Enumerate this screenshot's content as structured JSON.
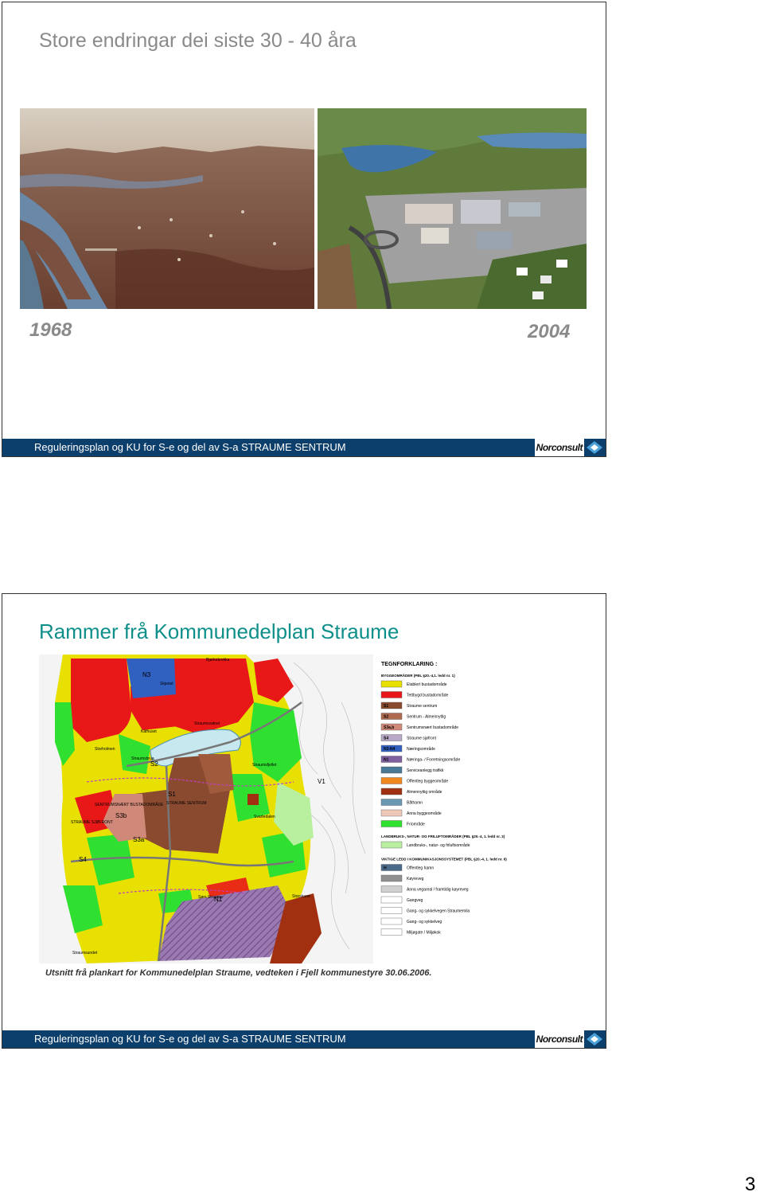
{
  "slides": [
    {
      "title": "Store endringar dei siste 30 - 40 åra",
      "photos": [
        {
          "year": "1968"
        },
        {
          "year": "2004"
        }
      ],
      "footer": "Reguleringsplan og KU for S-e og del av S-a STRAUME SENTRUM",
      "logo": "Norconsult"
    },
    {
      "title": "Rammer frå Kommunedelplan Straume",
      "map": {
        "labels": [
          "N3",
          "Skjenet",
          "S1",
          "STRAUME SENTRUM",
          "S2",
          "S3b",
          "S3a",
          "S4",
          "N1",
          "V1",
          "Storholmen",
          "Kåfhuset",
          "Straumsundet",
          "Sørs Straume",
          "Storskaret",
          "STRAUME SJØFRONT",
          "SENTRUMSNÆRT BUSTADOMRÅDE",
          "Straumsfjellet",
          "Svartedalen",
          "Bjørkebrekka",
          "Straumsvatnet",
          "Straumsbrua"
        ],
        "legend_title": "TEGNFORKLARING :",
        "legend_section1": "BYGGEOMRÅDER (PBL §20.-4,1. ledd nr. 1)",
        "legend_items1": [
          {
            "code": "",
            "label": "Etablert bustadområde",
            "color": "#e8e000"
          },
          {
            "code": "",
            "label": "Tettbygd bustadområde",
            "color": "#e81818"
          },
          {
            "code": "S1",
            "label": "Straume sentrum",
            "color": "#8a4a30"
          },
          {
            "code": "S2",
            "label": "Sentrum - Almennyttig",
            "color": "#b06a50"
          },
          {
            "code": "S3a,b",
            "label": "Sentrumsnært bustadområde",
            "color": "#d08878"
          },
          {
            "code": "S4",
            "label": "Straume sjøfront",
            "color": "#b8a8c8"
          },
          {
            "code": "N3-N4",
            "label": "Næringsområde",
            "color": "#3060c0"
          },
          {
            "code": "N1",
            "label": "Næringa- / Forretningsområde",
            "color": "#8060a0"
          },
          {
            "code": "",
            "label": "Serviceanlegg trafikk",
            "color": "#4a7a98"
          },
          {
            "code": "",
            "label": "Offentleg byggeområde",
            "color": "#f08820"
          },
          {
            "code": "",
            "label": "Almennyttig område",
            "color": "#a03010"
          },
          {
            "code": "",
            "label": "Båthamn",
            "color": "#6a98b0"
          },
          {
            "code": "",
            "label": "Anna byggeområde",
            "color": "#f0c8b8"
          },
          {
            "code": "",
            "label": "Friområde",
            "color": "#30e030"
          }
        ],
        "legend_section2": "LANDBRUKS-, NATUR- OG FRILUFTOMRÅDER (PBL §20.-4, 1. ledd nr. 2)",
        "legend_items2": [
          {
            "code": "",
            "label": "Landbruks-, natur- og friluftsområde",
            "color": "#b8f0a0"
          }
        ],
        "legend_section3": "VIKTIGE LEDD I KOMMUNIKASJONSSYSTEMET (PBL §20.-4, 1. ledd nr. 6)",
        "legend_items3": [
          {
            "code": "H",
            "label": "Offentleg hamn",
            "color": "#4a6a8a"
          },
          {
            "code": "",
            "label": "Køyreveg",
            "color": "#909090"
          },
          {
            "code": "",
            "label": "Anna vegareal / framtidig køyreveg",
            "color": "#d0d0d0"
          },
          {
            "code": "",
            "label": "Gangveg",
            "color": "#ffffff"
          },
          {
            "code": "",
            "label": "Gang- og sykkelvegen Straumemila",
            "color": "#ffffff"
          },
          {
            "code": "",
            "label": "Gang- og sykkelveg",
            "color": "#ffffff"
          },
          {
            "code": "",
            "label": "Miljøgate / Miljøkok",
            "color": "#ffffff"
          }
        ]
      },
      "caption": "Utsnitt frå plankart for Kommunedelplan Straume, vedteken i Fjell kommunestyre 30.06.2006.",
      "footer": "Reguleringsplan og KU for S-e og del av S-a STRAUME SENTRUM",
      "logo": "Norconsult"
    }
  ],
  "page_number": "3",
  "colors": {
    "footer_bg": "#0c3f6c",
    "title_teal": "#0f8f8a",
    "title_grey": "#8a8a8a"
  }
}
